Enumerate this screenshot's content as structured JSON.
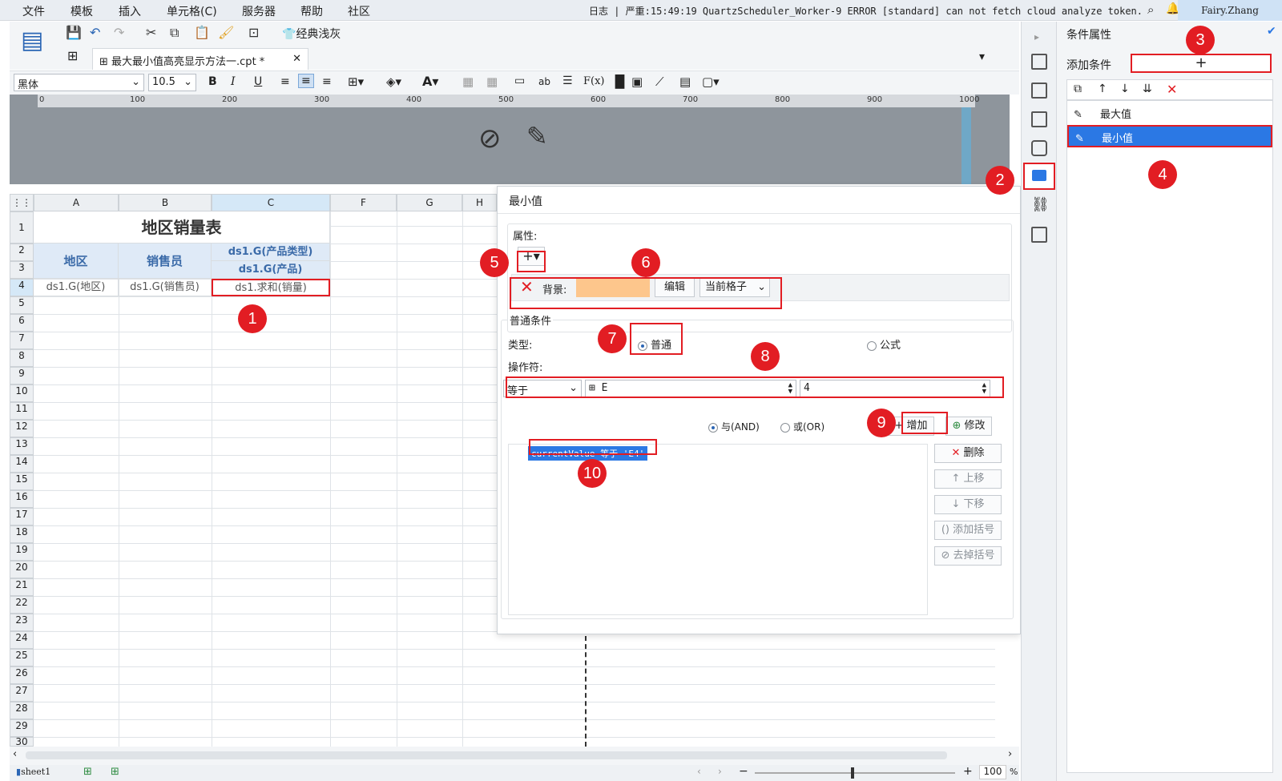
{
  "menu": [
    "文件",
    "模板",
    "插入",
    "单元格(C)",
    "服务器",
    "帮助",
    "社区"
  ],
  "log_text": "日志 | 严重:15:49:19 QuartzScheduler_Worker-9 ERROR [standard] can not fetch cloud analyze token.",
  "user": "Fairy.Zhang",
  "toolbar": {
    "classic_label": "经典浅灰"
  },
  "tab": {
    "title": "最大最小值高亮显示方法一.cpt *",
    "close": "✕"
  },
  "format": {
    "font": "黑体",
    "size": "10.5"
  },
  "ruler_ticks": [
    "0",
    "100",
    "200",
    "300",
    "400",
    "500",
    "600",
    "700",
    "800",
    "900",
    "1000"
  ],
  "columns": [
    "A",
    "B",
    "C",
    "F",
    "G",
    "H"
  ],
  "rows": [
    "1",
    "2",
    "3",
    "4",
    "5",
    "6",
    "7",
    "8",
    "9",
    "10",
    "11",
    "12",
    "13",
    "14",
    "15",
    "16",
    "17",
    "18",
    "19",
    "20",
    "21",
    "22",
    "23",
    "24",
    "25",
    "26",
    "27",
    "28",
    "29",
    "30"
  ],
  "sheet": {
    "title": "地区销量表",
    "h_region": "地区",
    "h_seller": "销售员",
    "h_type": "ds1.G(产品类型)",
    "h_product": "ds1.G(产品)",
    "d_region": "ds1.G(地区)",
    "d_seller": "ds1.G(销售员)",
    "d_sum": "ds1.求和(销量)"
  },
  "dialog": {
    "title": "最小值",
    "attr_label": "属性:",
    "bg_label": "背景:",
    "bg_color": "#fdc68c",
    "edit_btn": "编辑",
    "scope": "当前格子",
    "cond_group": "普通条件",
    "type_label": "类型:",
    "type_normal": "普通",
    "type_formula": "公式",
    "operator_label": "操作符:",
    "operator": "等于",
    "cell_ref": "E",
    "value": "4",
    "and_label": "与(AND)",
    "or_label": "或(OR)",
    "add_btn": "增加",
    "modify_btn": "修改",
    "condition": "currentValue 等于 'E4'",
    "delete_btn": "删除",
    "up_btn": "上移",
    "down_btn": "下移",
    "add_paren": "添加括号",
    "remove_paren": "去掉括号"
  },
  "right_panel": {
    "title": "条件属性",
    "add_cond": "添加条件",
    "items": [
      "最大值",
      "最小值"
    ]
  },
  "status": {
    "sheet": "sheet1",
    "zoom": "100",
    "pct": "%"
  },
  "badges": [
    "1",
    "2",
    "3",
    "4",
    "5",
    "6",
    "7",
    "8",
    "9",
    "10"
  ]
}
